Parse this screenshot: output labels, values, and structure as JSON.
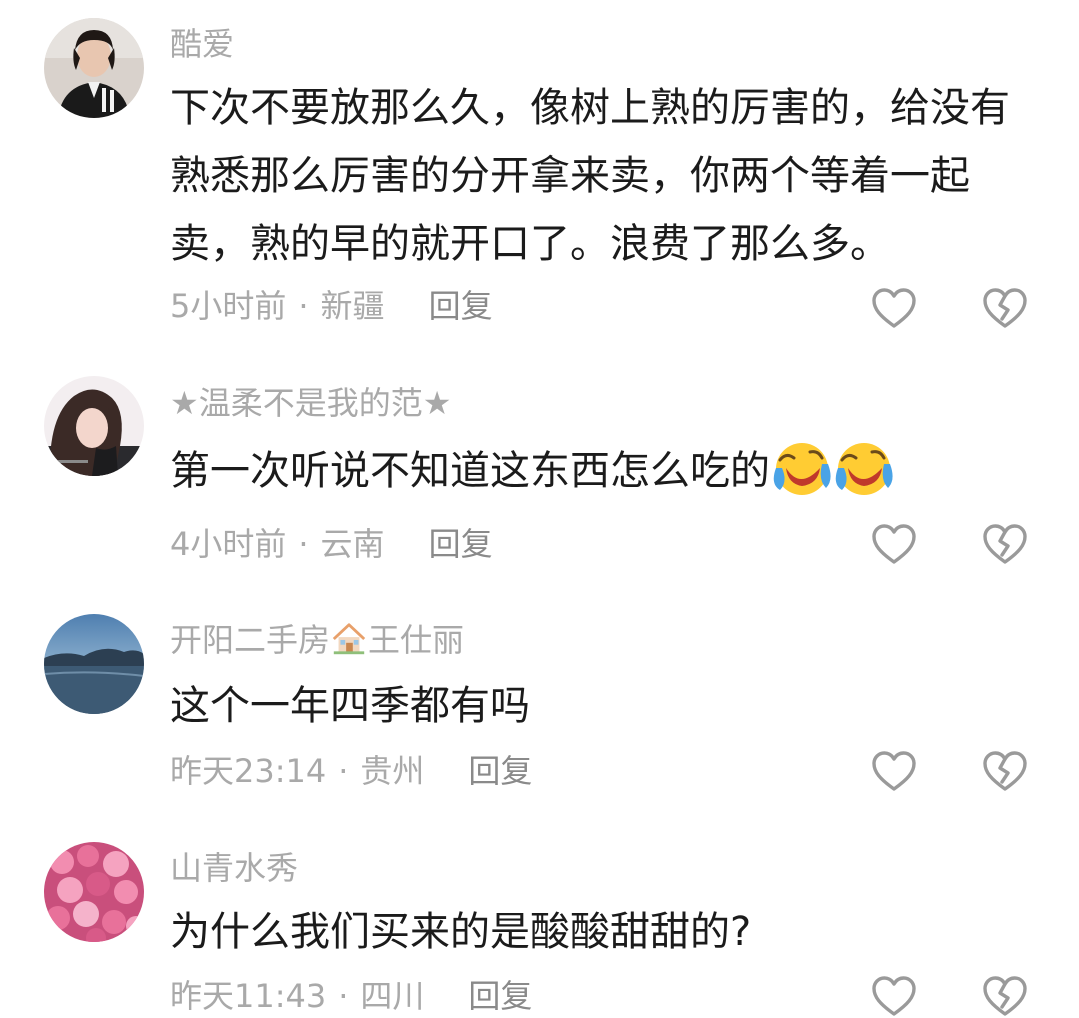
{
  "comments": [
    {
      "username": "酷爱",
      "text_lines": [
        "下次不要放那么久，像树上熟的厉害的，给没有",
        "熟悉那么厉害的分开拿来卖，你两个等着一起",
        "卖，熟的早的就开口了。浪费了那么多。"
      ],
      "time": "5小时前",
      "separator": "·",
      "location": "新疆",
      "reply_label": "回复"
    },
    {
      "username": "★温柔不是我的范★",
      "text_lines": [
        "第一次听说不知道这东西怎么吃的"
      ],
      "emojis": [
        "laughing-crying-emoji",
        "laughing-crying-emoji"
      ],
      "time": "4小时前",
      "separator": "·",
      "location": "云南",
      "reply_label": "回复"
    },
    {
      "username_part1": "开阳二手房",
      "username_emoji": "house-emoji",
      "username_part2": "王仕丽",
      "text_lines": [
        "这个一年四季都有吗"
      ],
      "time": "昨天23:14",
      "separator": "·",
      "location": "贵州",
      "reply_label": "回复"
    },
    {
      "username": "山青水秀",
      "text_lines": [
        "为什么我们买来的是酸酸甜甜的?"
      ],
      "time": "昨天11:43",
      "separator": "·",
      "location": "四川",
      "reply_label": "回复"
    }
  ],
  "colors": {
    "meta_gray": "#a9a9a9",
    "text": "#1b1b1b",
    "icon_gray": "#9a9a9a"
  }
}
